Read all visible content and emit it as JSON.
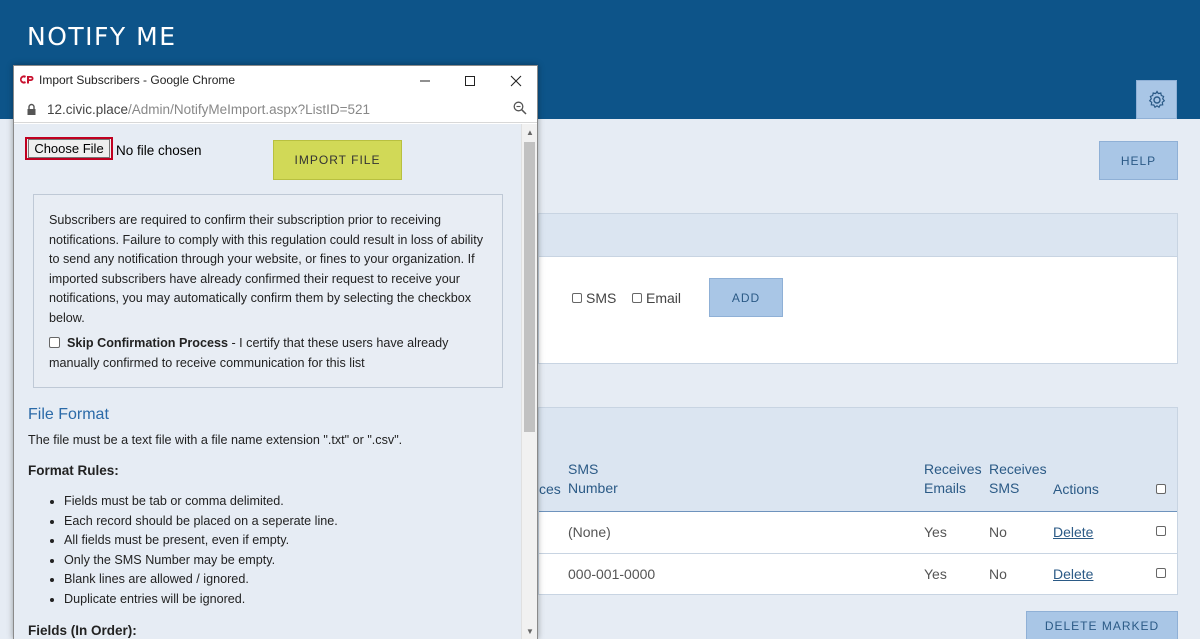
{
  "app": {
    "title": "NOTIFY ME",
    "help_label": "HELP",
    "add_label": "ADD",
    "sms_label": "SMS",
    "email_label": "Email",
    "delete_marked_label": "DELETE MARKED",
    "table": {
      "headers": {
        "preferences_fragment": "ces",
        "sms_line1": "SMS",
        "sms_line2": "Number",
        "emails_line1": "Receives",
        "emails_line2": "Emails",
        "recsms_line1": "Receives",
        "recsms_line2": "SMS",
        "actions": "Actions"
      },
      "rows": [
        {
          "sms_number": "(None)",
          "receives_emails": "Yes",
          "receives_sms": "No",
          "action": "Delete"
        },
        {
          "sms_number": "000-001-0000",
          "receives_emails": "Yes",
          "receives_sms": "No",
          "action": "Delete"
        }
      ]
    }
  },
  "popup": {
    "window_title": "Import Subscribers - Google Chrome",
    "url_host": "12.civic.place",
    "url_path": "/Admin/NotifyMeImport.aspx?ListID=521",
    "choose_file_label": "Choose File",
    "no_file_text": "No file chosen",
    "import_label": "IMPORT FILE",
    "notice_text": "Subscribers are required to confirm their subscription prior to receiving notifications. Failure to comply with this regulation could result in loss of ability to send any notification through your website, or fines to your organization. If imported subscribers have already confirmed their request to receive your notifications, you may automatically confirm them by selecting the checkbox below.",
    "skip_label": "Skip Confirmation Process",
    "skip_text": " - I certify that these users have already manually confirmed to receive communication for this list",
    "file_format_title": "File Format",
    "file_format_desc": "The file must be a text file with a file name extension \".txt\" or \".csv\".",
    "format_rules_title": "Format Rules:",
    "format_rules": [
      "Fields must be tab or comma delimited.",
      "Each record should be placed on a seperate line.",
      "All fields must be present, even if empty.",
      "Only the SMS Number may be empty.",
      "Blank lines are allowed / ignored.",
      "Duplicate entries will be ignored."
    ],
    "fields_title": "Fields (In Order):"
  },
  "colors": {
    "header_blue": "#0d5489",
    "button_blue": "#a9c6e6",
    "import_yellow": "#d1d957",
    "highlight_red": "#c00020"
  }
}
